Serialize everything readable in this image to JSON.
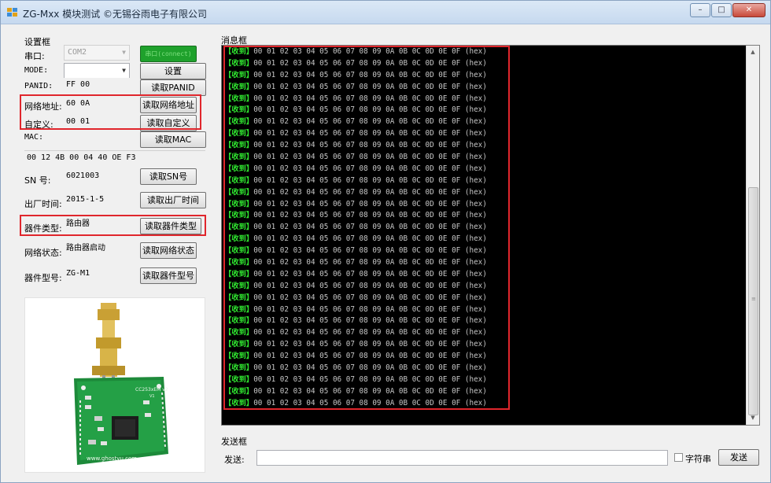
{
  "window": {
    "title": "ZG-Mxx 模块测试 ©无锡谷雨电子有限公司",
    "min_icon": "minimize-icon",
    "max_icon": "maximize-icon",
    "close_icon": "close-icon"
  },
  "settings": {
    "group_title": "设置框",
    "port": {
      "label": "串口:",
      "value": "COM2",
      "button": "串口(connect)"
    },
    "mode": {
      "label": "MODE:",
      "value": "",
      "button": "设置"
    },
    "panid": {
      "label": "PANID:",
      "value": "FF 00",
      "button": "读取PANID"
    },
    "netaddr": {
      "label": "网络地址:",
      "value": "60 0A",
      "button": "读取网络地址"
    },
    "custom": {
      "label": "自定义:",
      "value": "00 01",
      "button": "读取自定义"
    },
    "mac": {
      "label": "MAC:",
      "value": "00 12 4B 00 04 40 OE F3",
      "button": "读取MAC"
    },
    "sn": {
      "label": "SN 号:",
      "value": "6021003",
      "button": "读取SN号"
    },
    "factory": {
      "label": "出厂时间:",
      "value": "2015-1-5",
      "button": "读取出厂时间"
    },
    "devtype": {
      "label": "器件类型:",
      "value": "路由器",
      "button": "读取器件类型"
    },
    "netstate": {
      "label": "网络状态:",
      "value": "路由器启动",
      "button": "读取网络状态"
    },
    "model": {
      "label": "器件型号:",
      "value": "ZG-M1",
      "button": "读取器件型号"
    },
    "photo": {
      "antenna_text": "CC253xEM v2",
      "ver": "V1",
      "site": "www.ghostyu.com"
    }
  },
  "messages": {
    "group_title": "消息框",
    "lines": [
      {
        "tag": "【收到】",
        "hex": "00 01 02 03 04 05 06 07 08 09 0A 0B 0C 0D 0E 0F",
        "suffix": "(hex)"
      },
      {
        "tag": "【收到】",
        "hex": "00 01 02 03 04 05 06 07 08 09 0A 0B 0C 0D 0E 0F",
        "suffix": "(hex)"
      },
      {
        "tag": "【收到】",
        "hex": "00 01 02 03 04 05 06 07 08 09 0A 0B 0C 0D 0E 0F",
        "suffix": "(hex)"
      },
      {
        "tag": "【收到】",
        "hex": "00 01 02 03 04 05 06 07 08 09 0A 0B 0C 0D 0E 0F",
        "suffix": "(hex)"
      },
      {
        "tag": "【收到】",
        "hex": "00 01 02 03 04 05 06 07 08 09 0A 0B 0C 0D 0E 0F",
        "suffix": "(hex)"
      },
      {
        "tag": "【收到】",
        "hex": "00 01 02 03 04 05 06 07 08 09 0A 0B 0C 0D 0E 0F",
        "suffix": "(hex)"
      },
      {
        "tag": "【收到】",
        "hex": "00 01 02 03 04 05 06 07 08 09 0A 0B 0C 0D 0E 0F",
        "suffix": "(hex)"
      },
      {
        "tag": "【收到】",
        "hex": "00 01 02 03 04 05 06 07 08 09 0A 0B 0C 0D 0E 0F",
        "suffix": "(hex)"
      },
      {
        "tag": "【收到】",
        "hex": "00 01 02 03 04 05 06 07 08 09 0A 0B 0C 0D 0E 0F",
        "suffix": "(hex)"
      },
      {
        "tag": "【收到】",
        "hex": "00 01 02 03 04 05 06 07 08 09 0A 0B 0C 0D 0E 0F",
        "suffix": "(hex)"
      },
      {
        "tag": "【收到】",
        "hex": "00 01 02 03 04 05 06 07 08 09 0A 0B 0C 0D 0E 0F",
        "suffix": "(hex)"
      },
      {
        "tag": "【收到】",
        "hex": "00 01 02 03 04 05 06 07 08 09 0A 0B 0C 0D 0E 0F",
        "suffix": "(hex)"
      },
      {
        "tag": "【收到】",
        "hex": "00 01 02 03 04 05 06 07 08 09 0A 0B 0C 0D 0E 0F",
        "suffix": "(hex)"
      },
      {
        "tag": "【收到】",
        "hex": "00 01 02 03 04 05 06 07 08 09 0A 0B 0C 0D 0E 0F",
        "suffix": "(hex)"
      },
      {
        "tag": "【收到】",
        "hex": "00 01 02 03 04 05 06 07 08 09 0A 0B 0C 0D 0E 0F",
        "suffix": "(hex)"
      },
      {
        "tag": "【收到】",
        "hex": "00 01 02 03 04 05 06 07 08 09 0A 0B 0C 0D 0E 0F",
        "suffix": "(hex)"
      },
      {
        "tag": "【收到】",
        "hex": "00 01 02 03 04 05 06 07 08 09 0A 0B 0C 0D 0E 0F",
        "suffix": "(hex)"
      },
      {
        "tag": "【收到】",
        "hex": "00 01 02 03 04 05 06 07 08 09 0A 0B 0C 0D 0E 0F",
        "suffix": "(hex)"
      },
      {
        "tag": "【收到】",
        "hex": "00 01 02 03 04 05 06 07 08 09 0A 0B 0C 0D 0E 0F",
        "suffix": "(hex)"
      },
      {
        "tag": "【收到】",
        "hex": "00 01 02 03 04 05 06 07 08 09 0A 0B 0C 0D 0E 0F",
        "suffix": "(hex)"
      },
      {
        "tag": "【收到】",
        "hex": "00 01 02 03 04 05 06 07 08 09 0A 0B 0C 0D 0E 0F",
        "suffix": "(hex)"
      },
      {
        "tag": "【收到】",
        "hex": "00 01 02 03 04 05 06 07 08 09 0A 0B 0C 0D 0E 0F",
        "suffix": "(hex)"
      },
      {
        "tag": "【收到】",
        "hex": "00 01 02 03 04 05 06 07 08 09 0A 0B 0C 0D 0E 0F",
        "suffix": "(hex)"
      },
      {
        "tag": "【收到】",
        "hex": "00 01 02 03 04 05 06 07 08 09 0A 0B 0C 0D 0E 0F",
        "suffix": "(hex)"
      },
      {
        "tag": "【收到】",
        "hex": "00 01 02 03 04 05 06 07 08 09 0A 0B 0C 0D 0E 0F",
        "suffix": "(hex)"
      },
      {
        "tag": "【收到】",
        "hex": "00 01 02 03 04 05 06 07 08 09 0A 0B 0C 0D 0E 0F",
        "suffix": "(hex)"
      },
      {
        "tag": "【收到】",
        "hex": "00 01 02 03 04 05 06 07 08 09 0A 0B 0C 0D 0E 0F",
        "suffix": "(hex)"
      },
      {
        "tag": "【收到】",
        "hex": "00 01 02 03 04 05 06 07 08 09 0A 0B 0C 0D 0E 0F",
        "suffix": "(hex)"
      },
      {
        "tag": "【收到】",
        "hex": "00 01 02 03 04 05 06 07 08 09 0A 0B 0C 0D 0E 0F",
        "suffix": "(hex)"
      },
      {
        "tag": "【收到】",
        "hex": "00 01 02 03 04 05 06 07 08 09 0A 0B 0C 0D 0E 0F",
        "suffix": "(hex)"
      },
      {
        "tag": "【收到】",
        "hex": "00 01 02 03 04 05 06 07 08 09 0A 0B 0C 0D 0E 0F",
        "suffix": "(hex)"
      }
    ]
  },
  "send": {
    "group_title": "发送框",
    "label": "发送:",
    "value": "",
    "checkbox_label": "字符串",
    "checkbox_checked": false,
    "button": "发送"
  },
  "colors": {
    "highlight": "#e0262c",
    "console_bg": "#000000",
    "tag_green": "#2fe32f",
    "connect_green": "#1fa12c"
  }
}
